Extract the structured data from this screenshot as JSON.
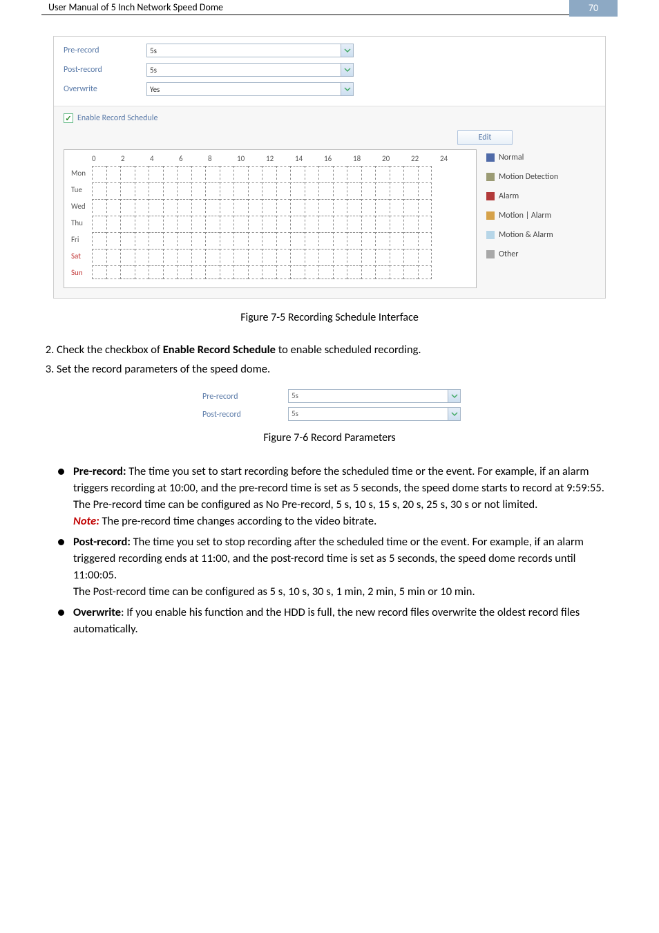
{
  "header": {
    "title": "User Manual of 5 Inch Network Speed Dome",
    "page_num": "70"
  },
  "panel": {
    "pre_record_label": "Pre-record",
    "pre_record_value": "5s",
    "post_record_label": "Post-record",
    "post_record_value": "5s",
    "overwrite_label": "Overwrite",
    "overwrite_value": "Yes",
    "enable_label": "Enable Record Schedule",
    "edit_label": "Edit",
    "hours": [
      "0",
      "2",
      "4",
      "6",
      "8",
      "10",
      "12",
      "14",
      "16",
      "18",
      "20",
      "22",
      "24"
    ],
    "days": [
      {
        "label": "Mon",
        "weekend": false
      },
      {
        "label": "Tue",
        "weekend": false
      },
      {
        "label": "Wed",
        "weekend": false
      },
      {
        "label": "Thu",
        "weekend": false
      },
      {
        "label": "Fri",
        "weekend": false
      },
      {
        "label": "Sat",
        "weekend": true
      },
      {
        "label": "Sun",
        "weekend": true
      }
    ],
    "legend": [
      {
        "label": "Normal",
        "color": "#4f6aa8"
      },
      {
        "label": "Motion Detection",
        "color": "#9b9b74"
      },
      {
        "label": "Alarm",
        "color": "#b23a3a"
      },
      {
        "label": "Motion | Alarm",
        "color": "#d6a24a"
      },
      {
        "label": "Motion & Alarm",
        "color": "#b7d6e8"
      },
      {
        "label": "Other",
        "color": "#a8a8a8"
      }
    ]
  },
  "fig75": "Figure 7-5 Recording Schedule Interface",
  "steps": {
    "s2a": "Check the checkbox of ",
    "s2b": "Enable Record Schedule",
    "s2c": " to enable scheduled recording.",
    "s3": "Set the record parameters of the speed dome."
  },
  "params_box": {
    "pre_label": "Pre-record",
    "pre_value": "5s",
    "post_label": "Post-record",
    "post_value": "5s"
  },
  "fig76": "Figure 7-6 Record Parameters",
  "bullets": {
    "pre_title": "Pre-record:",
    "pre_text": " The time you set to start recording before the scheduled time or the event. For example, if an alarm triggers recording at 10:00, and the pre-record time is set as 5 seconds, the speed dome starts to record at 9:59:55.",
    "pre_text2": "The Pre-record time can be configured as No Pre-record, 5 s, 10 s, 15 s, 20 s, 25 s, 30 s or not limited.",
    "note_label": "Note:",
    "note_text": " The pre-record time changes according to the video bitrate.",
    "post_title": "Post-record:",
    "post_text": " The time you set to stop recording after the scheduled time or the event. For example, if an alarm triggered recording ends at 11:00, and the post-record time is set as 5 seconds, the speed dome records until 11:00:05.",
    "post_text2": "The Post-record time can be configured as 5 s, 10 s, 30 s, 1 min, 2 min, 5 min or 10 min.",
    "ow_title": "Overwrite",
    "ow_text": ": If you enable his function and the HDD is full, the new record files overwrite the oldest record files automatically."
  }
}
